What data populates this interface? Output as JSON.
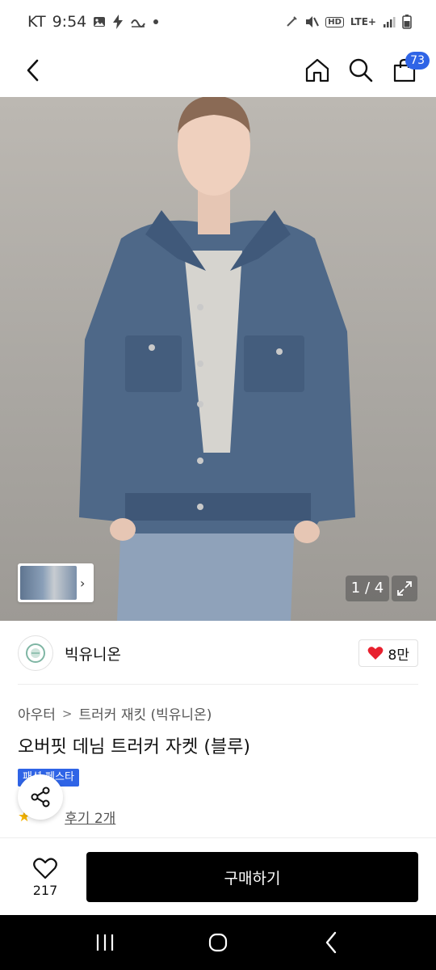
{
  "status_bar": {
    "carrier": "KT",
    "time": "9:54",
    "network": "LTE+",
    "hd": "HD",
    "icons_left": [
      "image-icon",
      "bolt-icon",
      "wave-icon",
      "dot-icon"
    ],
    "icons_right": [
      "vibrate-icon",
      "mute-icon",
      "hd-icon",
      "lte-icon",
      "signal-icon",
      "battery-icon"
    ]
  },
  "header": {
    "back_icon": "chevron-left-icon",
    "home_icon": "home-icon",
    "search_icon": "search-icon",
    "cart_icon": "shopping-bag-icon",
    "cart_count": "73"
  },
  "gallery": {
    "page_indicator": "1 / 4",
    "thumb_arrow": "›",
    "expand_icon": "expand-icon"
  },
  "brand": {
    "name": "빅유니온",
    "like_count": "8만",
    "like_icon": "heart-filled-icon"
  },
  "product": {
    "breadcrumb": [
      "아우터",
      "트러커 재킷 (빅유니온)"
    ],
    "breadcrumb_separator": ">",
    "title": "오버핏 데님 트러커 자켓 (블루)",
    "event_badge": "패션 페스타",
    "review_star": "★",
    "review_text": "후기 2개"
  },
  "action_bar": {
    "wish_count": "217",
    "buy_label": "구매하기"
  },
  "colors": {
    "accent": "#2f64e6",
    "heart": "#e8202e",
    "buy_bg": "#000000",
    "nav_bg": "#000000"
  },
  "nav_bar": {
    "recent_icon": "recent-apps-icon",
    "home_icon": "home-circle-icon",
    "back_icon": "back-icon"
  }
}
